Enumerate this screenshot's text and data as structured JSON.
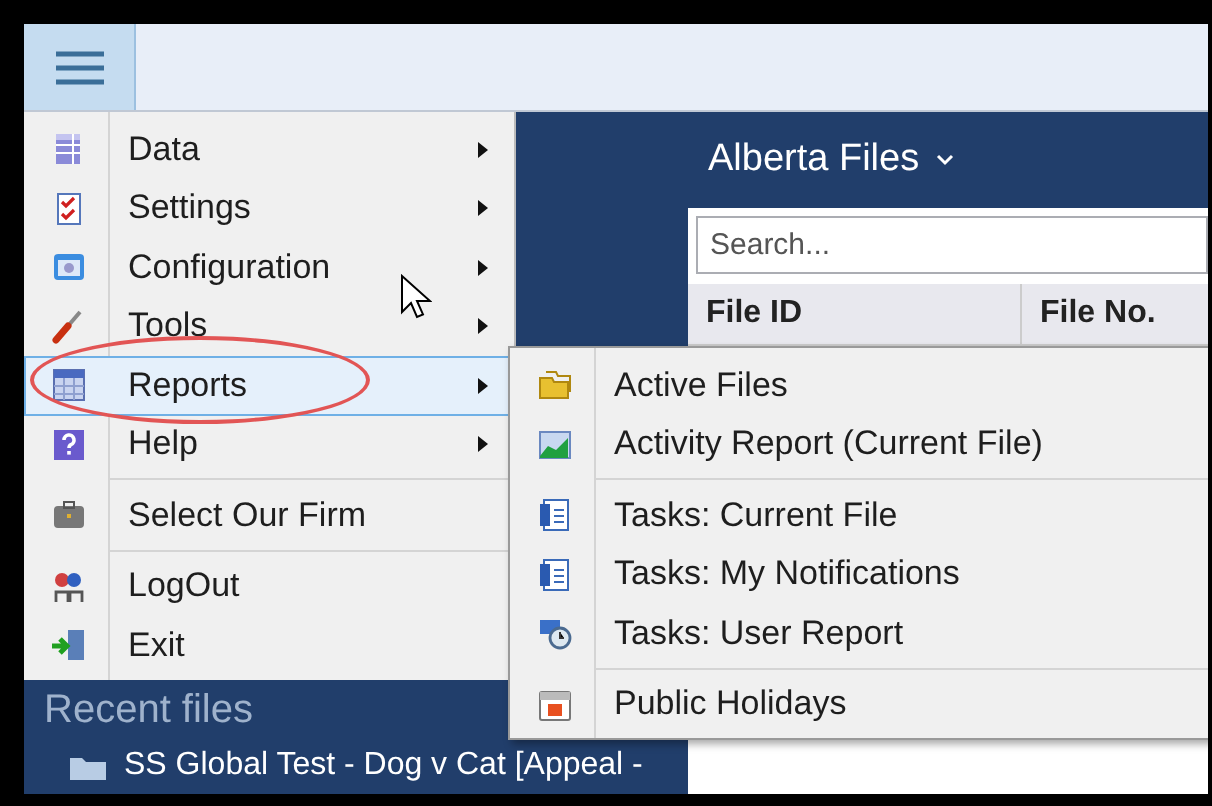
{
  "main_menu": {
    "groups": [
      {
        "items": [
          {
            "label": "Data",
            "has_submenu": true,
            "selected": false
          },
          {
            "label": "Settings",
            "has_submenu": true,
            "selected": false
          },
          {
            "label": "Configuration",
            "has_submenu": true,
            "selected": false
          },
          {
            "label": "Tools",
            "has_submenu": true,
            "selected": false
          },
          {
            "label": "Reports",
            "has_submenu": true,
            "selected": true
          },
          {
            "label": "Help",
            "has_submenu": true,
            "selected": false
          }
        ]
      },
      {
        "items": [
          {
            "label": "Select Our Firm",
            "has_submenu": false,
            "selected": false
          }
        ]
      },
      {
        "items": [
          {
            "label": "LogOut",
            "has_submenu": false,
            "selected": false
          },
          {
            "label": "Exit",
            "has_submenu": false,
            "selected": false
          }
        ]
      }
    ]
  },
  "reports_submenu": {
    "groups": [
      {
        "items": [
          {
            "label": "Active Files",
            "has_submenu": false,
            "selected": false
          },
          {
            "label": "Activity Report (Current File)",
            "has_submenu": false,
            "selected": false
          }
        ]
      },
      {
        "items": [
          {
            "label": "Tasks: Current File",
            "has_submenu": false,
            "selected": false
          },
          {
            "label": "Tasks: My Notifications",
            "has_submenu": false,
            "selected": false
          },
          {
            "label": "Tasks: User Report",
            "has_submenu": false,
            "selected": false
          }
        ]
      },
      {
        "items": [
          {
            "label": "Public Holidays",
            "has_submenu": false,
            "selected": false
          }
        ]
      }
    ]
  },
  "files_panel": {
    "title": "Alberta Files",
    "search": {
      "placeholder": "Search..."
    },
    "table": {
      "columns": [
        "File ID",
        "File No."
      ]
    }
  },
  "recent_files": {
    "title": "Recent files",
    "items": [
      "SS Global Test - Dog v Cat [Appeal -"
    ]
  }
}
